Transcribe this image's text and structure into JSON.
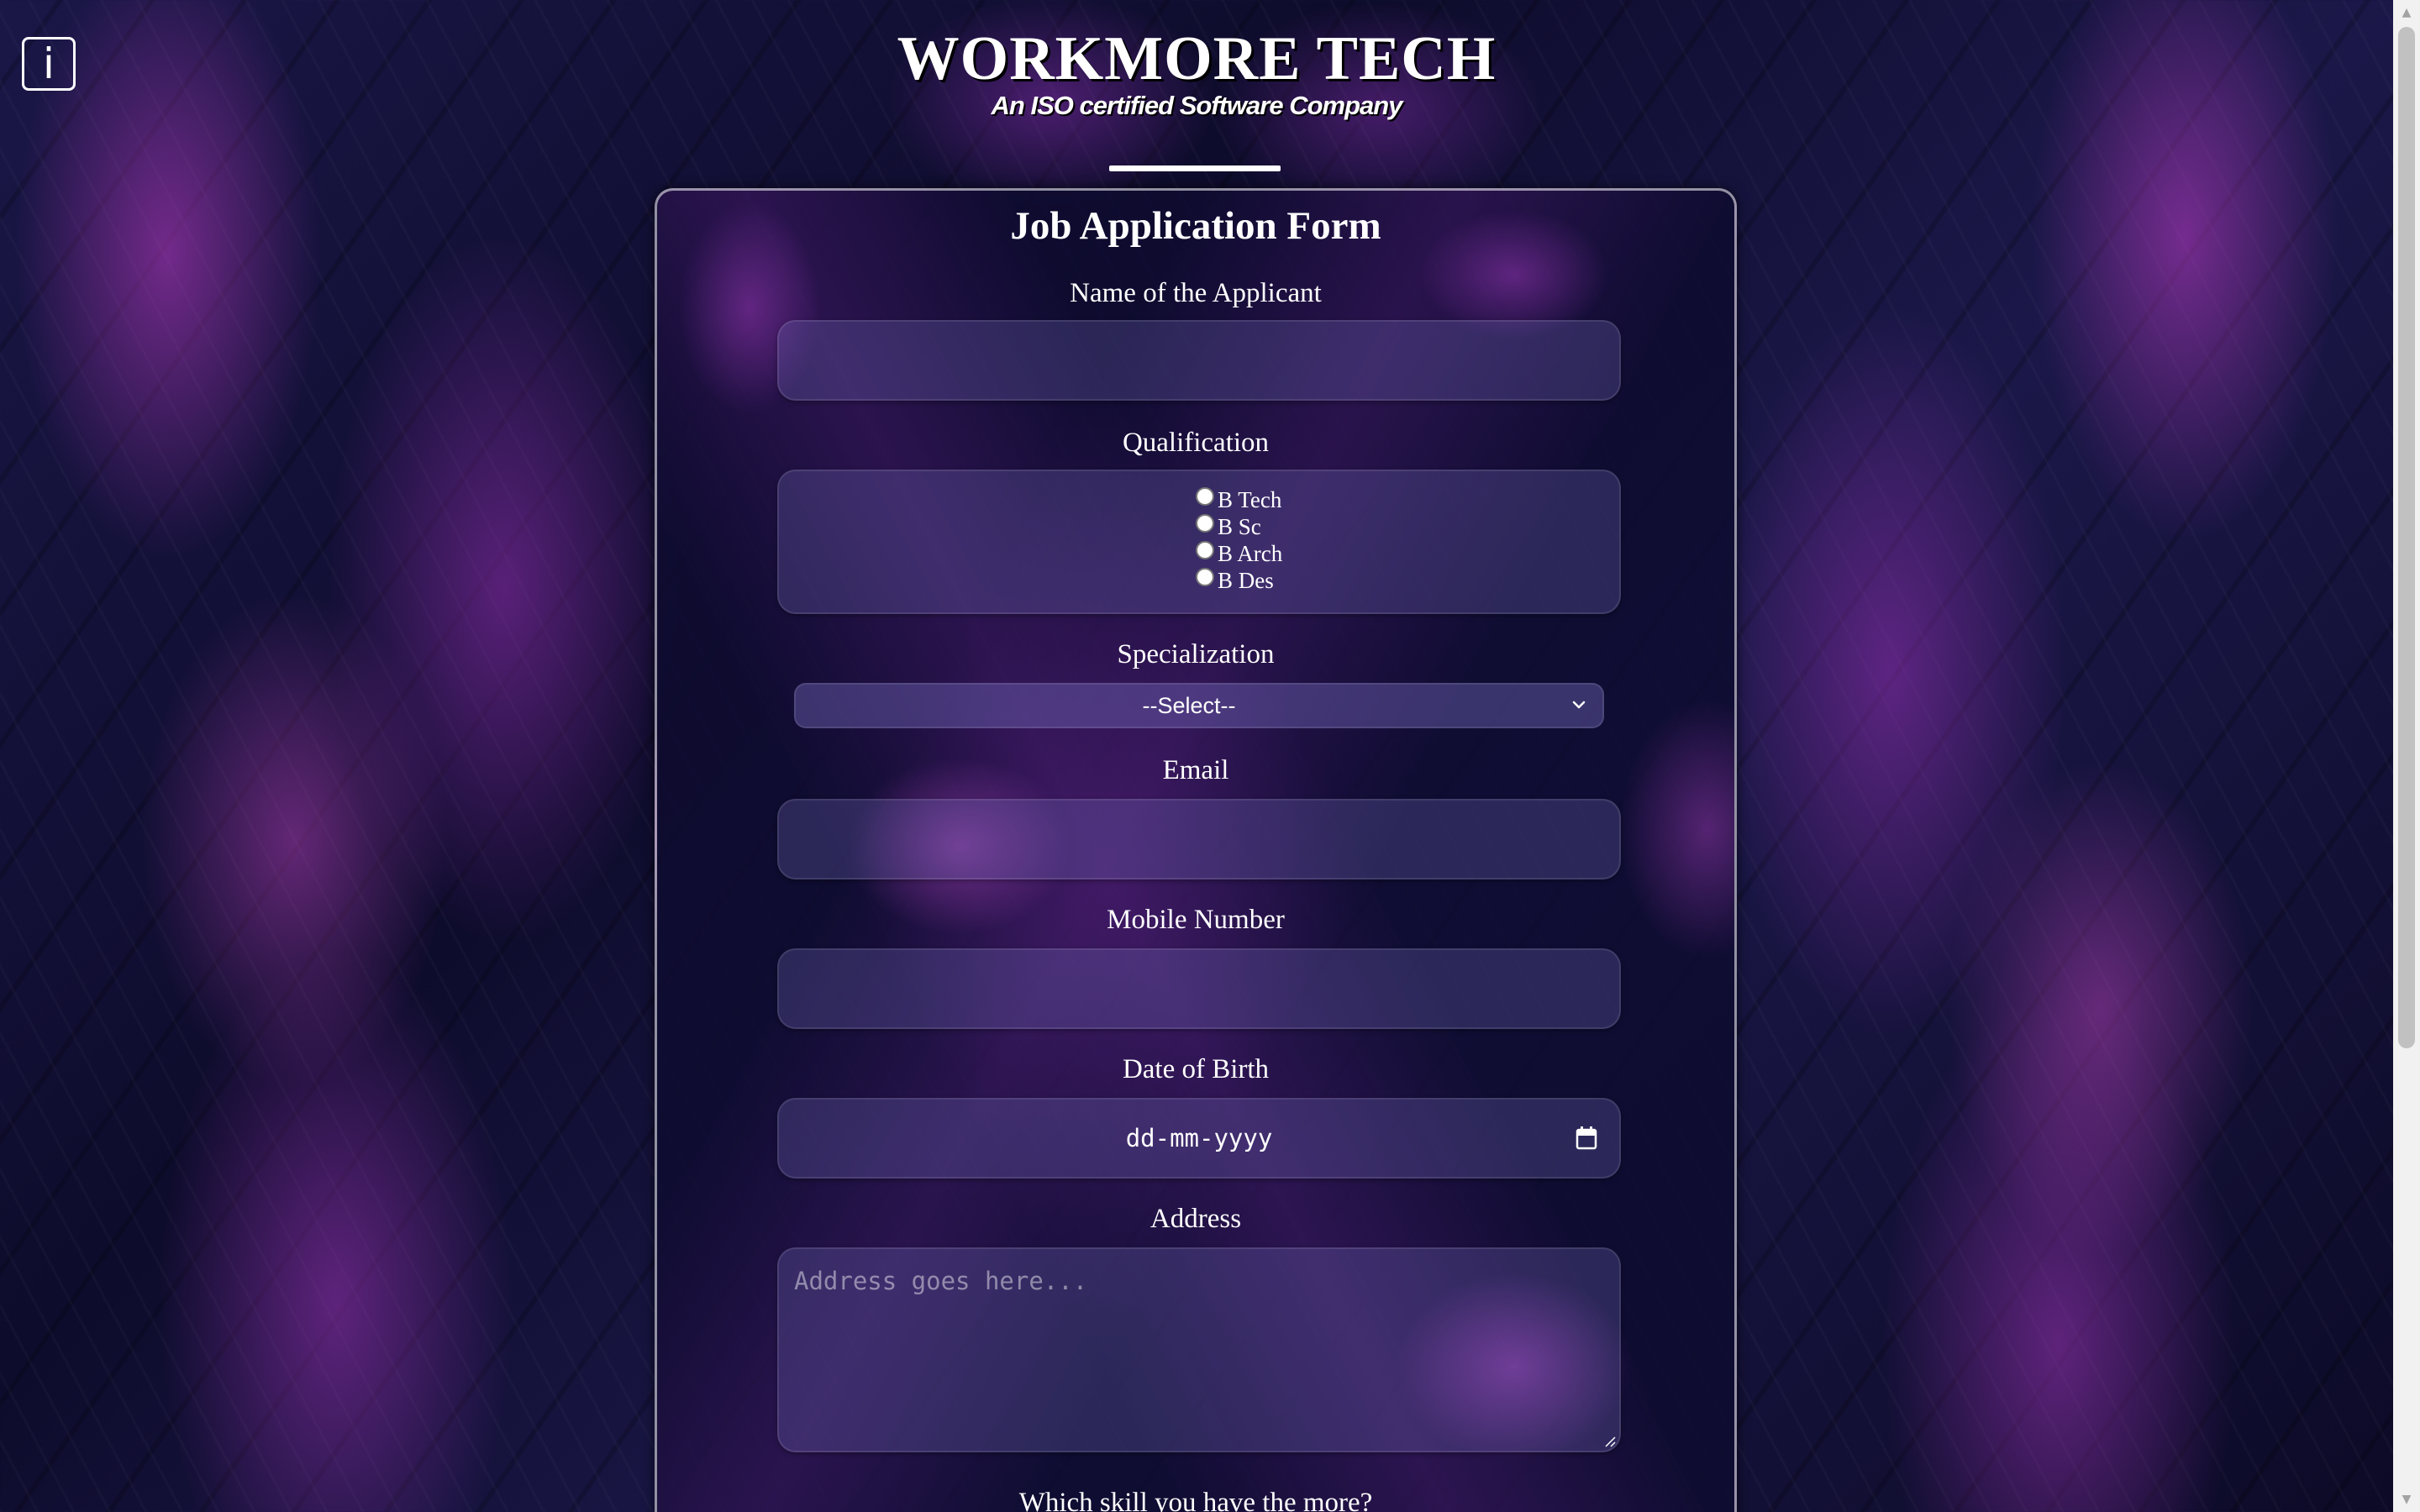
{
  "header": {
    "info_icon_glyph": "i",
    "company_name": "WORKMORE TECH",
    "tagline": "An ISO certified Software Company"
  },
  "form": {
    "title": "Job Application Form",
    "name": {
      "label": "Name of the Applicant",
      "value": ""
    },
    "qualification": {
      "label": "Qualification",
      "options": [
        "B Tech",
        "B Sc",
        "B Arch",
        "B Des"
      ]
    },
    "specialization": {
      "label": "Specialization",
      "selected": "--Select--"
    },
    "email": {
      "label": "Email",
      "value": ""
    },
    "mobile": {
      "label": "Mobile Number",
      "value": ""
    },
    "dob": {
      "label": "Date of Birth",
      "placeholder": "dd-mm-yyyy"
    },
    "address": {
      "label": "Address",
      "placeholder": "Address goes here..."
    },
    "skill": {
      "label": "Which skill you have the more?"
    }
  },
  "colors": {
    "text": "#ffffff",
    "background": "#120f33",
    "accent": "#b03cc8"
  }
}
